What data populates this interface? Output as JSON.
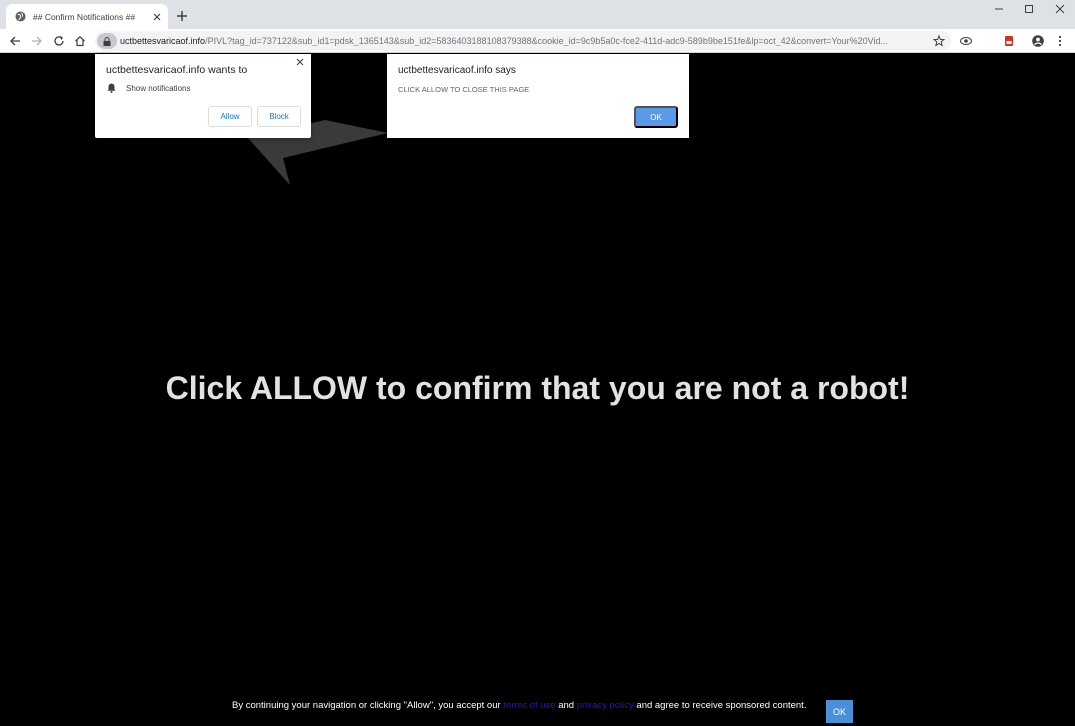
{
  "browser": {
    "tab_title": "## Confirm Notifications ##",
    "url_host": "uctbettesvaricaof.info",
    "url_path": "/PIVL?tag_id=737122&sub_id1=pdsk_1365143&sub_id2=5836403188108379388&cookie_id=9c9b5a0c-fce2-411d-adc9-589b9be151fe&lp=oct_42&convert=Your%20Vid..."
  },
  "permission_popup": {
    "title": "uctbettesvaricaof.info wants to",
    "row_label": "Show notifications",
    "allow_label": "Allow",
    "block_label": "Block"
  },
  "alert_dialog": {
    "title": "uctbettesvaricaof.info says",
    "message": "CLICK ALLOW TO CLOSE THIS PAGE",
    "ok_label": "OK"
  },
  "page": {
    "headline": "Click ALLOW to confirm that you are not a robot!",
    "footer": {
      "text_1": "By continuing your navigation or clicking \"Allow\", you accept our ",
      "terms_link": "terms of use",
      "text_2": " and ",
      "privacy_link": "privacy policy",
      "text_3": " and agree to receive sponsored content.",
      "ok_label": "OK"
    }
  },
  "colors": {
    "page_background": "#000000",
    "headline": "#e2e2e2",
    "accent_button": "#5b9ae8"
  }
}
